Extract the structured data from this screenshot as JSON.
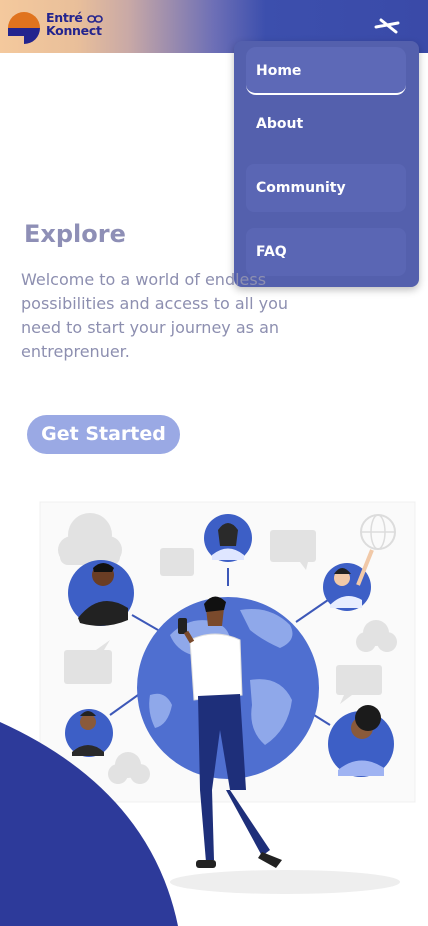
{
  "header": {
    "logo_line1": "Entré",
    "logo_line2": "Konnect"
  },
  "menu": {
    "items": [
      {
        "label": "Home"
      },
      {
        "label": "About"
      },
      {
        "label": "Community"
      },
      {
        "label": "FAQ"
      }
    ]
  },
  "hero": {
    "title": "Explore",
    "description": "Welcome to a world of endless possibilities and access to all you need to start your journey as an entreprenuer.",
    "cta_label": "Get Started"
  },
  "colors": {
    "brand_navy": "#23248e",
    "brand_orange": "#e0731e",
    "menu_bg": "#5460ad",
    "cta_bg": "#9aa9e4",
    "accent_blue": "#2d3a9a"
  },
  "icons": {
    "close": "close-icon",
    "logo": "logo-icon",
    "illustration": "global-network-illustration"
  }
}
